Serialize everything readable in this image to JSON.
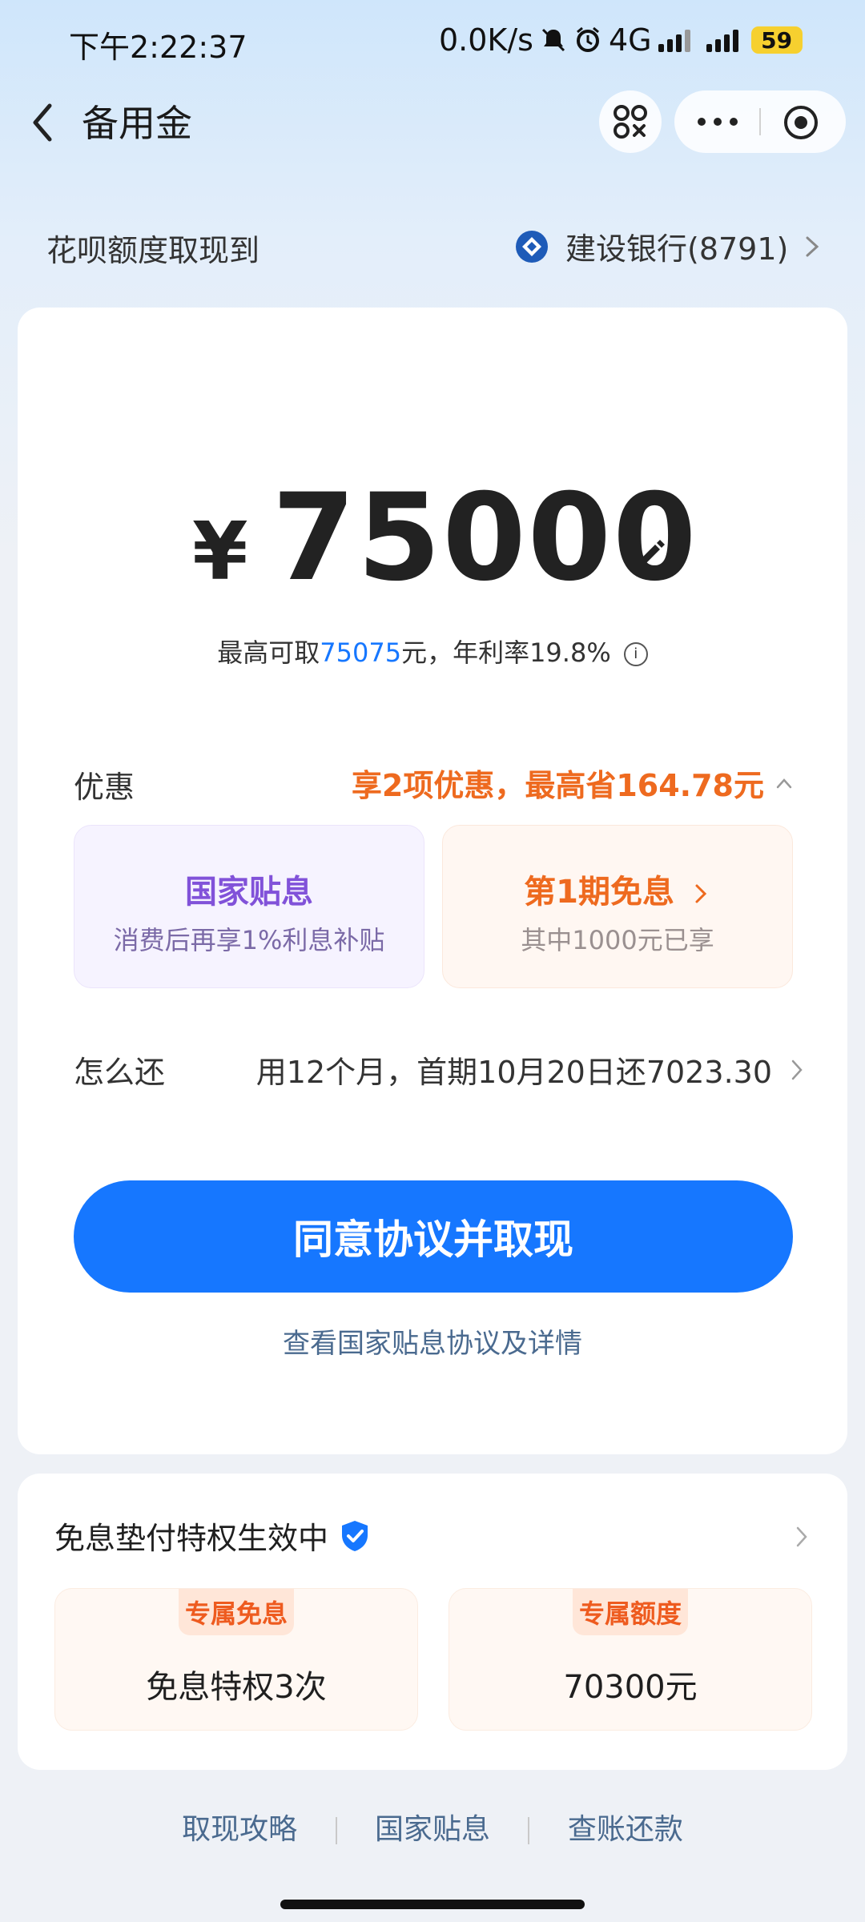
{
  "status_bar": {
    "time": "下午2:22:37",
    "net_speed": "0.0K/s",
    "network": "4G",
    "battery": "59"
  },
  "nav": {
    "title": "备用金"
  },
  "withdraw": {
    "label": "花呗额度取现到",
    "bank": "建设银行(8791)"
  },
  "amount": {
    "currency": "¥",
    "value": "75000"
  },
  "limit": {
    "prefix": "最高可取",
    "max": "75075",
    "suffix": "元，年利率19.8%"
  },
  "discount": {
    "label": "优惠",
    "summary": "享2项优惠，最高省164.78元",
    "box1": {
      "title": "国家贴息",
      "sub": "消费后再享1%利息补贴"
    },
    "box2": {
      "title": "第1期免息",
      "sub": "其中1000元已享"
    }
  },
  "repay": {
    "label": "怎么还",
    "value": "用12个月，首期10月20日还7023.30"
  },
  "cta": {
    "label": "同意协议并取现",
    "agreement_link": "查看国家贴息协议及详情"
  },
  "privilege": {
    "title": "免息垫付特权生效中",
    "box1": {
      "tag": "专属免息",
      "value": "免息特权3次"
    },
    "box2": {
      "tag": "专属额度",
      "value": "70300元"
    }
  },
  "footer": {
    "links": [
      "取现攻略",
      "国家贴息",
      "查账还款"
    ]
  },
  "colors": {
    "primary": "#1677ff",
    "accent_orange": "#ee6a1f",
    "accent_purple": "#8152d9"
  }
}
